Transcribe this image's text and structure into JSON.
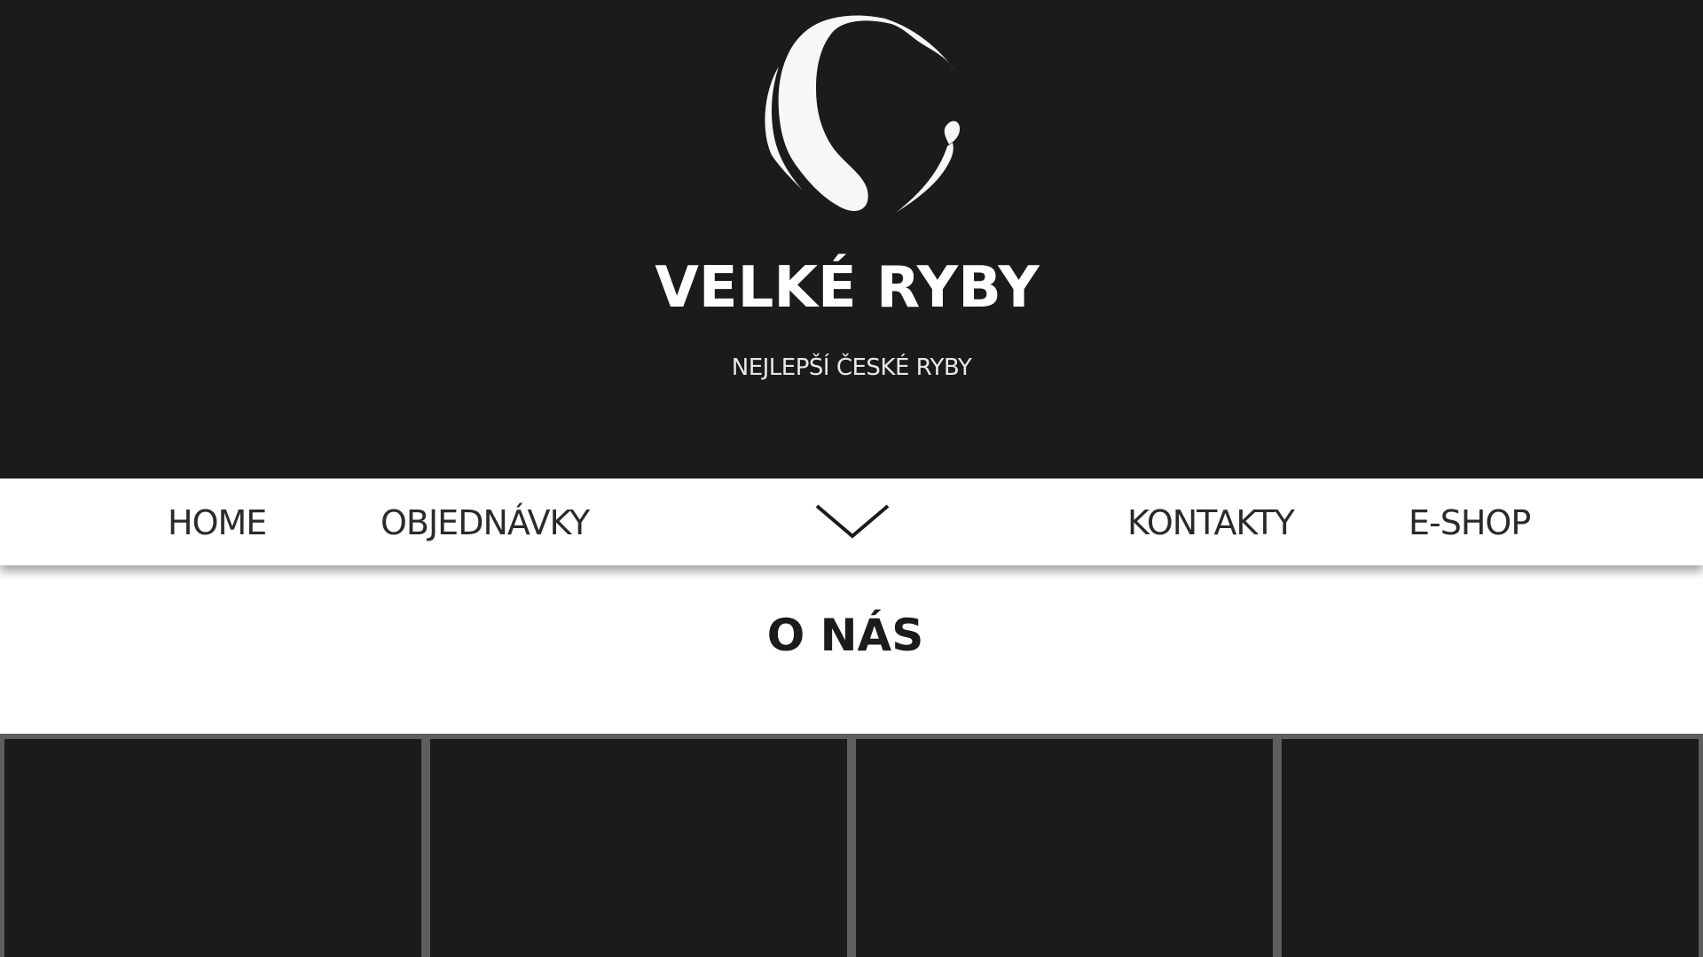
{
  "brand": {
    "title": "VELKÉ RYBY",
    "subtitle": "NEJLEPŠÍ ČESKÉ RYBY",
    "logo_icon": "fish-circle-logo-icon"
  },
  "nav": {
    "items": [
      {
        "label": "HOME"
      },
      {
        "label": "OBJEDNÁVKY"
      },
      {
        "label": "KONTAKTY"
      },
      {
        "label": "E-SHOP"
      }
    ],
    "toggle_icon": "chevron-down-icon"
  },
  "main": {
    "section_title": "O NÁS"
  },
  "gallery": {
    "tile_count": 4
  },
  "colors": {
    "hero_background": "#1b1b1b",
    "nav_background": "#ffffff",
    "tile_border": "#5e5e5e",
    "text_dark": "#1b1b1b",
    "text_light": "#ffffff"
  }
}
